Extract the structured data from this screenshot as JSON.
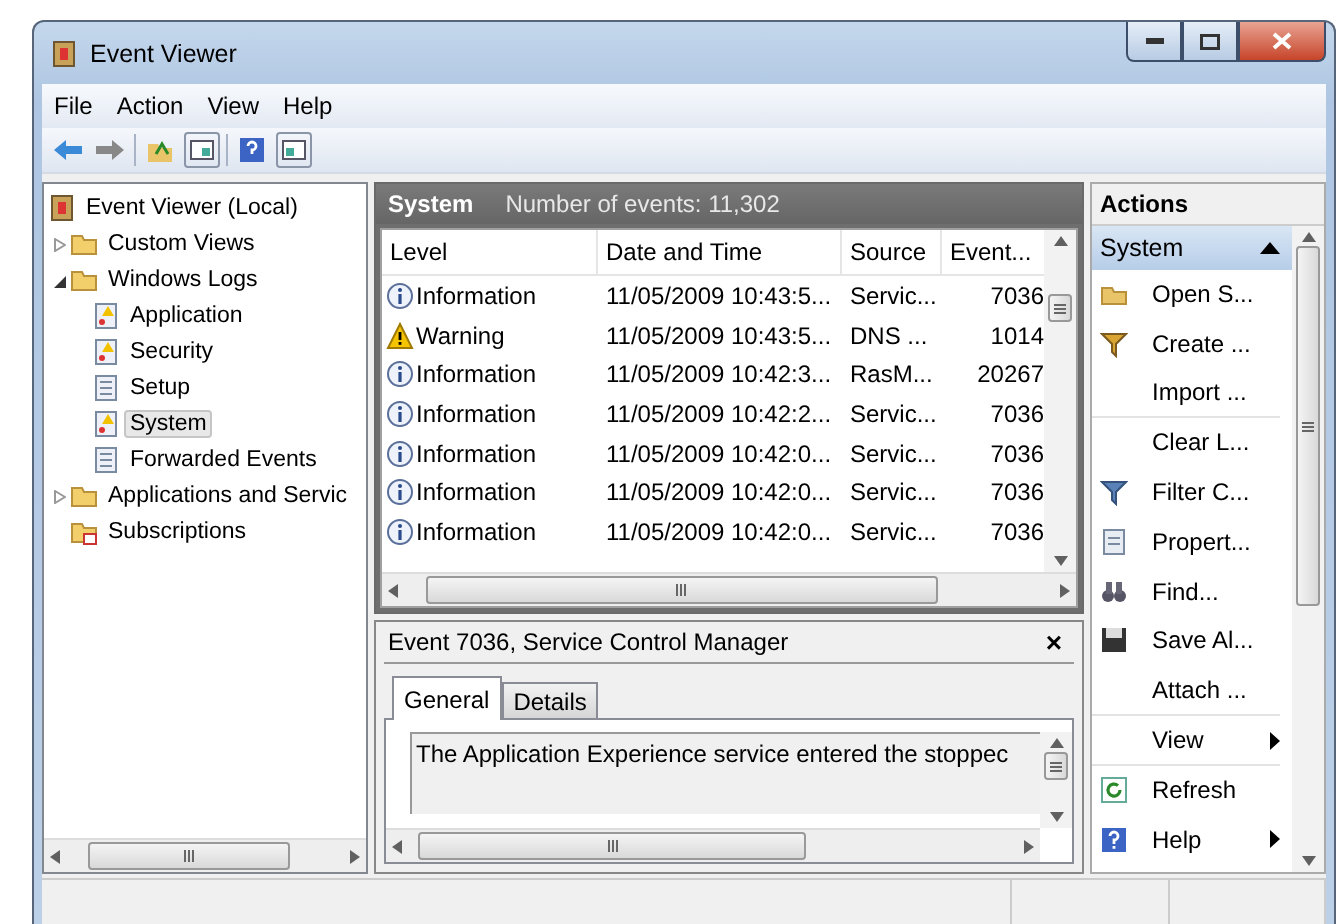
{
  "window": {
    "title": "Event Viewer"
  },
  "menu": [
    "File",
    "Action",
    "View",
    "Help"
  ],
  "tree": [
    {
      "label": "Event Viewer (Local)",
      "kind": "viewer",
      "selected": false,
      "children": [
        {
          "label": "Custom Views",
          "kind": "folder",
          "selected": false,
          "expanded": false
        },
        {
          "label": "Windows Logs",
          "kind": "folder",
          "selected": false,
          "expanded": true,
          "children": [
            {
              "label": "Application",
              "kind": "alert-log",
              "selected": false
            },
            {
              "label": "Security",
              "kind": "alert-log",
              "selected": false
            },
            {
              "label": "Setup",
              "kind": "log",
              "selected": false
            },
            {
              "label": "System",
              "kind": "alert-log",
              "selected": true
            },
            {
              "label": "Forwarded Events",
              "kind": "log",
              "selected": false
            }
          ]
        },
        {
          "label": "Applications and Servic",
          "kind": "folder",
          "selected": false,
          "expanded": false
        },
        {
          "label": "Subscriptions",
          "kind": "subscriptions",
          "selected": false
        }
      ]
    }
  ],
  "log_header": {
    "title": "System",
    "count": "Number of events: 11,302"
  },
  "table": {
    "columns": [
      "Level",
      "Date and Time",
      "Source",
      "Event..."
    ],
    "rows": [
      {
        "level": "Information",
        "kind": "info",
        "date": "11/05/2009 10:43:5...",
        "source": "Servic...",
        "event": "7036"
      },
      {
        "level": "Warning",
        "kind": "warning",
        "date": "11/05/2009 10:43:5...",
        "source": "DNS ...",
        "event": "1014"
      },
      {
        "level": "Information",
        "kind": "info",
        "date": "11/05/2009 10:42:3...",
        "source": "RasM...",
        "event": "20267"
      },
      {
        "level": "Information",
        "kind": "info",
        "date": "11/05/2009 10:42:2...",
        "source": "Servic...",
        "event": "7036"
      },
      {
        "level": "Information",
        "kind": "info",
        "date": "11/05/2009 10:42:0...",
        "source": "Servic...",
        "event": "7036"
      },
      {
        "level": "Information",
        "kind": "info",
        "date": "11/05/2009 10:42:0...",
        "source": "Servic...",
        "event": "7036"
      },
      {
        "level": "Information",
        "kind": "info",
        "date": "11/05/2009 10:42:0...",
        "source": "Servic...",
        "event": "7036"
      }
    ]
  },
  "detail": {
    "title": "Event 7036, Service Control Manager",
    "close": "×",
    "tabs": [
      {
        "label": "General",
        "selected": true
      },
      {
        "label": "Details",
        "selected": false
      }
    ],
    "message": "The Application Experience service entered the stoppec"
  },
  "actions": {
    "title": "Actions",
    "section": "System",
    "items": [
      {
        "label": "Open S...",
        "kind": "folder",
        "submenu": false,
        "separator_after": false
      },
      {
        "label": "Create ...",
        "kind": "filter-gold",
        "submenu": false,
        "separator_after": false
      },
      {
        "label": "Import ...",
        "kind": "plain",
        "submenu": false,
        "separator_after": true
      },
      {
        "label": "Clear L...",
        "kind": "plain",
        "submenu": false,
        "separator_after": false
      },
      {
        "label": "Filter C...",
        "kind": "filter",
        "submenu": false,
        "separator_after": false
      },
      {
        "label": "Propert...",
        "kind": "properties",
        "submenu": false,
        "separator_after": false
      },
      {
        "label": "Find...",
        "kind": "binoculars",
        "submenu": false,
        "separator_after": false
      },
      {
        "label": "Save Al...",
        "kind": "disk",
        "submenu": false,
        "separator_after": false
      },
      {
        "label": "Attach ...",
        "kind": "plain",
        "submenu": false,
        "separator_after": true
      },
      {
        "label": "View",
        "kind": "plain",
        "submenu": true,
        "separator_after": true
      },
      {
        "label": "Refresh",
        "kind": "refresh",
        "submenu": false,
        "separator_after": false
      },
      {
        "label": "Help",
        "kind": "help",
        "submenu": true,
        "separator_after": false
      }
    ]
  }
}
